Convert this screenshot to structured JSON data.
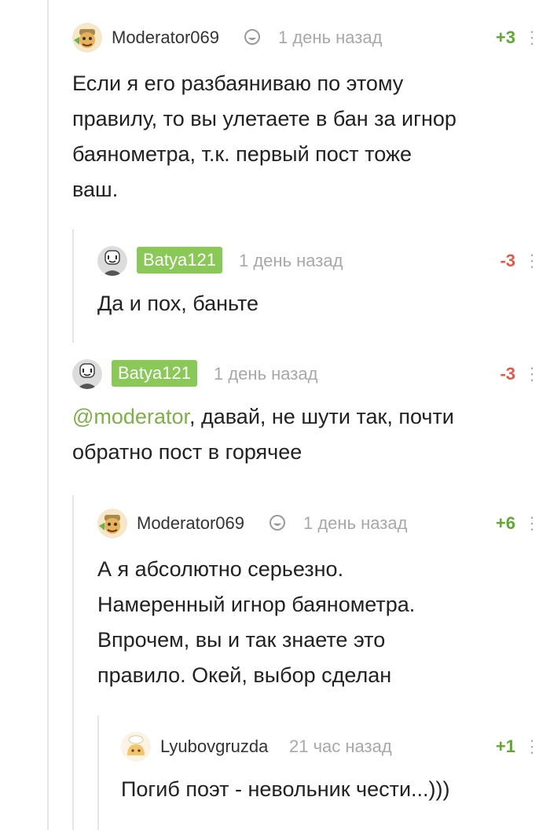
{
  "comments": [
    {
      "author": "Moderator069",
      "time": "1 день назад",
      "rating": "+3",
      "text": "Если я его разбаяниваю по этому\nправилу, то вы улетаете в бан за игнор\nбаянометра, т.к. первый пост тоже\nваш."
    },
    {
      "author": "Batya121",
      "time": "1 день назад",
      "rating": "-3",
      "text": "Да и пох, баньте"
    },
    {
      "author": "Batya121",
      "time": "1 день назад",
      "rating": "-3",
      "mention": "@moderator",
      "text": ", давай, не шути так, почти\nобратно пост в горячее"
    },
    {
      "author": "Moderator069",
      "time": "1 день назад",
      "rating": "+6",
      "text": "А я абсолютно серьезно.\nНамеренный игнор баянометра.\nВпрочем, вы и так знаете это\nправило. Окей, выбор сделан"
    },
    {
      "author": "Lyubovgruzda",
      "time": "21 час назад",
      "rating": "+1",
      "text": "Погиб поэт - невольник чести...)))"
    }
  ],
  "colors": {
    "positive": "#5fa832",
    "negative": "#e05a47",
    "author_badge": "#8ac858",
    "mention": "#7db047",
    "thread_line": "#e5e5e5"
  },
  "icons": {
    "moderator": "moderator-shield-icon",
    "more": "vertical-dots-icon"
  }
}
